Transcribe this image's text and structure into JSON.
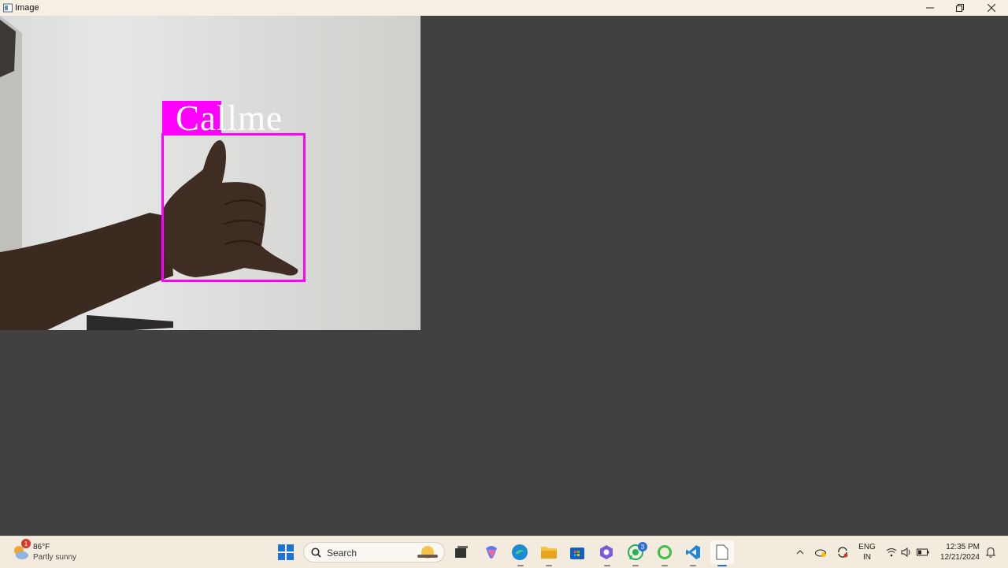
{
  "window": {
    "title": "Image"
  },
  "detection": {
    "label": "Callme",
    "box_color": "#ff00ff"
  },
  "taskbar": {
    "weather": {
      "temp": "86°F",
      "condition": "Partly sunny",
      "badge": "1"
    },
    "search": {
      "placeholder": "Search"
    },
    "whatsapp_badge": "3",
    "lang": {
      "line1": "ENG",
      "line2": "IN"
    },
    "clock": {
      "time": "12:35 PM",
      "date": "12/21/2024"
    }
  },
  "colors": {
    "background": "#414141",
    "titlebar": "#f5efe4",
    "taskbar": "#f3ebde",
    "accent": "#ff00ff"
  }
}
